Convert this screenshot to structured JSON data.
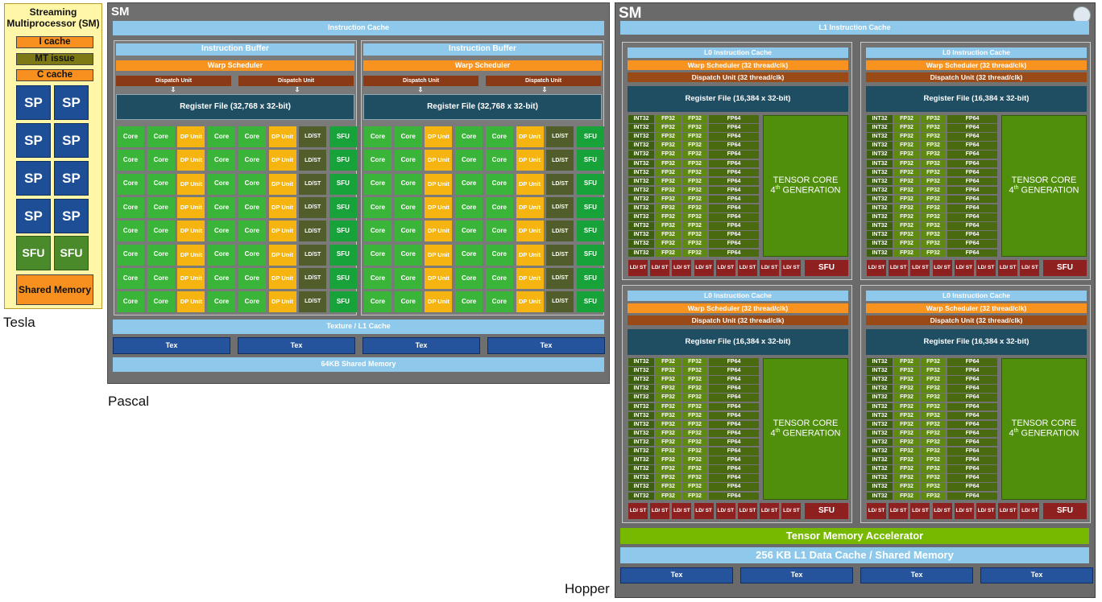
{
  "captions": {
    "tesla": "Tesla",
    "pascal": "Pascal",
    "hopper": "Hopper"
  },
  "tesla": {
    "title": "Streaming Multiprocessor (SM)",
    "icache": "I cache",
    "mt_issue": "MT issue",
    "ccache": "C cache",
    "sp": "SP",
    "sfu": "SFU",
    "shared_memory": "Shared Memory"
  },
  "pascal": {
    "title": "SM",
    "instruction_cache": "Instruction Cache",
    "instruction_buffer": "Instruction Buffer",
    "warp_scheduler": "Warp Scheduler",
    "dispatch_unit": "Dispatch Unit",
    "register_file": "Register File (32,768 x 32-bit)",
    "row_units": [
      "Core",
      "Core",
      "DP Unit",
      "Core",
      "Core",
      "DP Unit",
      "LD/ST",
      "SFU"
    ],
    "tex_l1": "Texture / L1 Cache",
    "tex": "Tex",
    "shared_memory": "64KB Shared Memory"
  },
  "hopper": {
    "title": "SM",
    "l1_instruction_cache": "L1 Instruction Cache",
    "l0_instruction_cache": "L0 Instruction Cache",
    "warp_scheduler": "Warp Scheduler (32 thread/clk)",
    "dispatch_unit": "Dispatch Unit (32 thread/clk)",
    "register_file": "Register File (16,384 x 32-bit)",
    "int32": "INT32",
    "fp32": "FP32",
    "fp64": "FP64",
    "tensor_core_line1": "TENSOR CORE",
    "tensor_core_line2a": "4",
    "tensor_core_sup": "th",
    "tensor_core_line2b": " GENERATION",
    "ldst": "LD/ ST",
    "sfu": "SFU",
    "tma": "Tensor Memory Accelerator",
    "l1_data_cache": "256 KB L1 Data Cache / Shared Memory",
    "tex": "Tex"
  }
}
